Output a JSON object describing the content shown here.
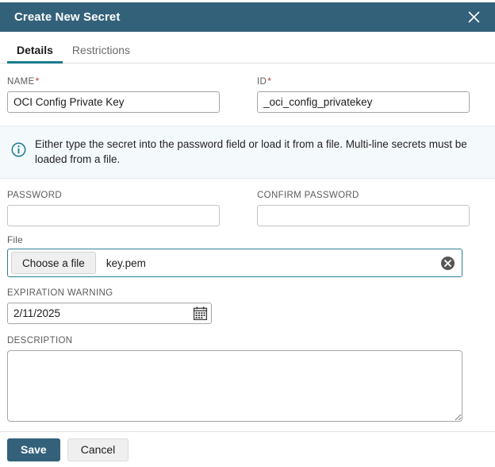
{
  "dialog": {
    "title": "Create New Secret",
    "close_icon": "close-icon"
  },
  "tabs": [
    {
      "label": "Details",
      "active": true
    },
    {
      "label": "Restrictions",
      "active": false
    }
  ],
  "fields": {
    "name": {
      "label": "NAME",
      "required_marker": "*",
      "value": "OCI Config Private Key",
      "placeholder": ""
    },
    "id": {
      "label": "ID",
      "required_marker": "*",
      "value": "_oci_config_privatekey",
      "placeholder": ""
    },
    "password": {
      "label": "PASSWORD",
      "value": "",
      "placeholder": ""
    },
    "confirm_password": {
      "label": "CONFIRM PASSWORD",
      "value": "",
      "placeholder": ""
    },
    "file": {
      "label": "File",
      "choose_button_label": "Choose a file",
      "file_name": "key.pem",
      "clear_icon": "clear-circle-icon"
    },
    "expiration_warning": {
      "label": "EXPIRATION WARNING",
      "value": "2/11/2025",
      "calendar_icon": "calendar-icon"
    },
    "description": {
      "label": "DESCRIPTION",
      "value": "",
      "placeholder": ""
    }
  },
  "banner": {
    "icon": "info-circle-icon",
    "text": "Either type the secret into the password field or load it from a file. Multi-line secrets must be loaded from a file."
  },
  "footer": {
    "save_label": "Save",
    "cancel_label": "Cancel"
  },
  "colors": {
    "header": "#33617a",
    "tab_accent": "#1a7b8c",
    "required": "#c0392b",
    "banner_bg": "#f4f9fc",
    "info_icon": "#1a7b94",
    "focus_border": "#2e7f94",
    "primary_button": "#33617a"
  }
}
